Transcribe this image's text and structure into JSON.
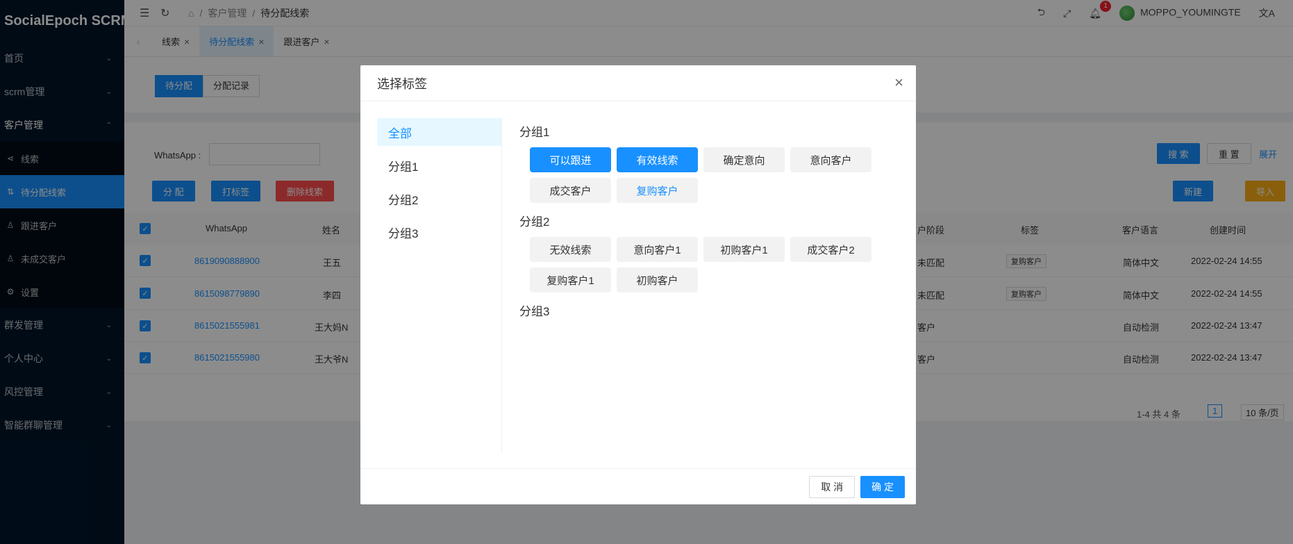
{
  "app": {
    "title": "SocialEpoch SCRM"
  },
  "sidebar": {
    "menus": [
      {
        "label": "首页"
      },
      {
        "label": "scrm管理"
      },
      {
        "label": "客户管理"
      }
    ],
    "sub": [
      {
        "label": "线索",
        "icon": "share-icon"
      },
      {
        "label": "待分配线索",
        "icon": "assign-icon"
      },
      {
        "label": "跟进客户",
        "icon": "user-icon"
      },
      {
        "label": "未成交客户",
        "icon": "user-icon"
      },
      {
        "label": "设置",
        "icon": "gear-icon"
      }
    ],
    "menus_after": [
      {
        "label": "群发管理"
      },
      {
        "label": "个人中心"
      },
      {
        "label": "风控管理"
      },
      {
        "label": "智能群聊管理"
      }
    ]
  },
  "breadcrumb": {
    "items": [
      "客户管理",
      "待分配线索"
    ]
  },
  "topbar": {
    "notification_count": "1",
    "username": "MOPPO_YOUMINGTE"
  },
  "tabs": [
    {
      "label": "线索"
    },
    {
      "label": "待分配线索"
    },
    {
      "label": "跟进客户"
    }
  ],
  "page": {
    "segment": [
      "待分配",
      "分配记录"
    ],
    "filter_label": "WhatsApp :",
    "search": "搜 索",
    "reset": "重 置",
    "expand": "展开",
    "actions": {
      "assign": "分 配",
      "tag": "打标签",
      "delete": "删除线索",
      "new": "新建",
      "import": "导入"
    },
    "columns": [
      "WhatsApp",
      "姓名",
      "户阶段",
      "标签",
      "客户语言",
      "创建时间"
    ],
    "rows": [
      {
        "phone": "8619090888900",
        "name": "王五",
        "stage": "未匹配",
        "tag": "复购客户",
        "lang": "简体中文",
        "time": "2022-02-24 14:55"
      },
      {
        "phone": "8615098779890",
        "name": "李四",
        "stage": "未匹配",
        "tag": "复购客户",
        "lang": "简体中文",
        "time": "2022-02-24 14:55"
      },
      {
        "phone": "8615021555981",
        "name": "王大妈N",
        "stage": "客户",
        "tag": "",
        "lang": "自动检测",
        "time": "2022-02-24 13:47"
      },
      {
        "phone": "8615021555980",
        "name": "王大爷N",
        "stage": "客户",
        "tag": "",
        "lang": "自动检测",
        "time": "2022-02-24 13:47"
      }
    ],
    "pagination": {
      "total": "1-4 共 4 条",
      "page": "1",
      "size": "10 条/页"
    }
  },
  "modal": {
    "title": "选择标签",
    "groups": [
      "全部",
      "分组1",
      "分组2",
      "分组3"
    ],
    "sections": [
      {
        "title": "分组1",
        "tags": [
          "可以跟进",
          "有效线索",
          "确定意向",
          "意向客户",
          "成交客户",
          "复购客户"
        ]
      },
      {
        "title": "分组2",
        "tags": [
          "无效线索",
          "意向客户1",
          "初购客户1",
          "成交客户2",
          "复购客户1",
          "初购客户"
        ]
      },
      {
        "title": "分组3",
        "tags": []
      }
    ],
    "cancel": "取 消",
    "ok": "确 定"
  }
}
